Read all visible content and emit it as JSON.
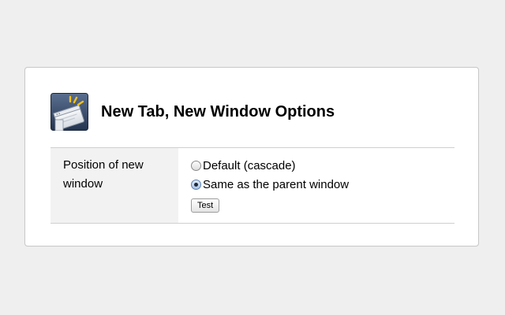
{
  "page": {
    "title": "New Tab, New Window Options",
    "icon": "browser-window-new-icon"
  },
  "options": {
    "position_label": "Position of new window",
    "choices": [
      {
        "label": "Default (cascade)",
        "checked": false
      },
      {
        "label": "Same as the parent window",
        "checked": true
      }
    ],
    "test_button_label": "Test"
  },
  "colors": {
    "page_background": "#efefef",
    "card_background": "#ffffff",
    "label_cell_background": "#f2f2f2",
    "icon_background": "#3b4f6e"
  }
}
